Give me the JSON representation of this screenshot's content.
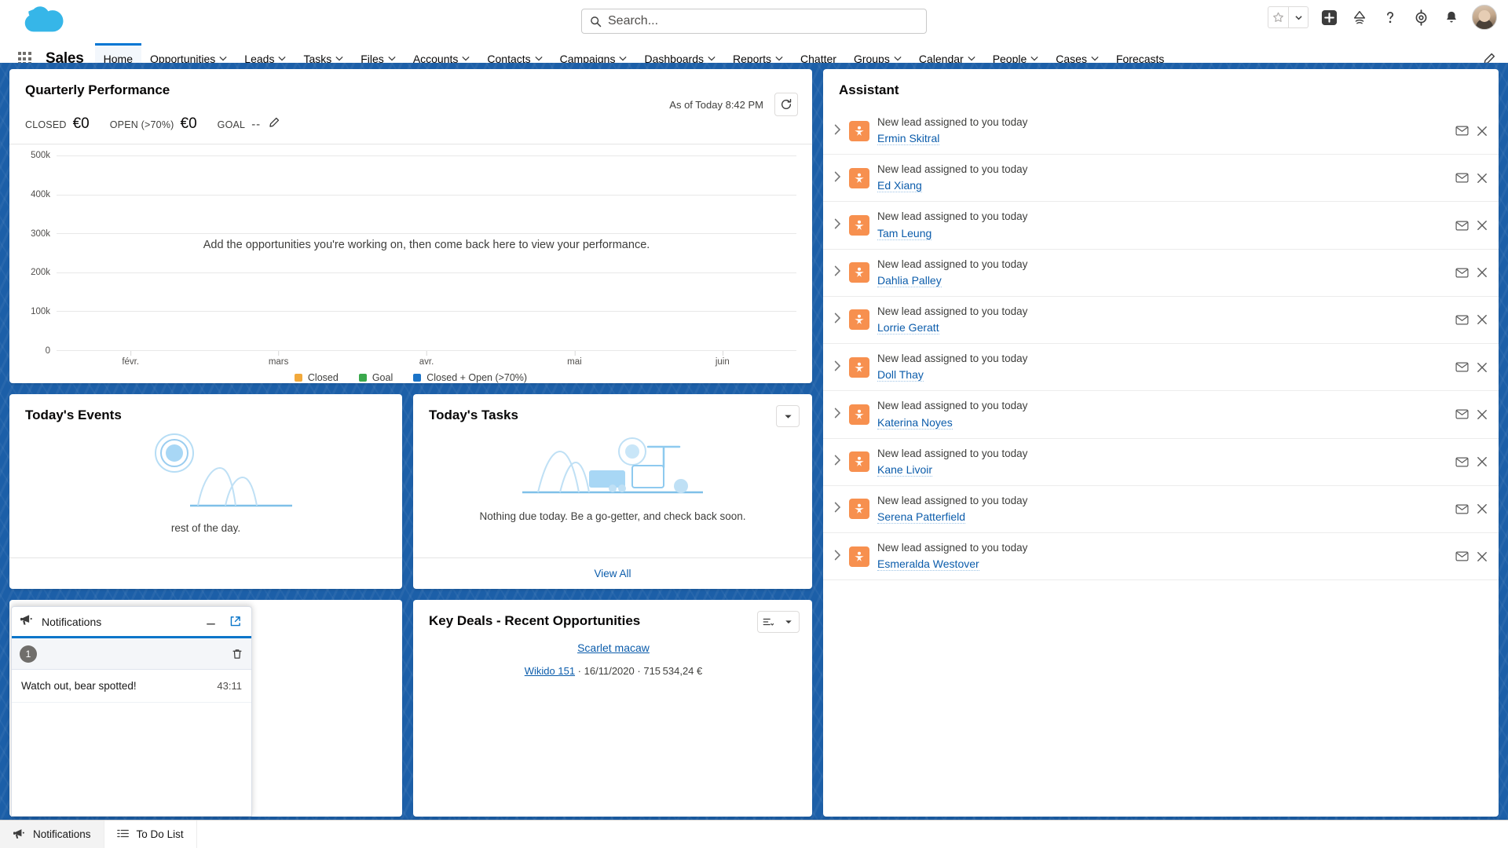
{
  "header": {
    "logo_icon": "salesforce-cloud-logo",
    "search": {
      "placeholder": "Search...",
      "icon": "search-icon",
      "value": ""
    },
    "icons": {
      "favorite": "star-icon",
      "favorite_caret": "chevron-down-icon",
      "add": "plus-circle-icon",
      "learning": "trailhead-icon",
      "help": "question-mark-icon",
      "setup": "gear-icon",
      "notifications": "bell-icon",
      "avatar": "user-avatar"
    }
  },
  "nav": {
    "waffle_icon": "app-launcher-icon",
    "app_name": "Sales",
    "edit_icon": "pencil-icon",
    "items": [
      {
        "label": "Home",
        "has_caret": false,
        "active": true
      },
      {
        "label": "Opportunities",
        "has_caret": true,
        "active": false
      },
      {
        "label": "Leads",
        "has_caret": true,
        "active": false
      },
      {
        "label": "Tasks",
        "has_caret": true,
        "active": false
      },
      {
        "label": "Files",
        "has_caret": true,
        "active": false
      },
      {
        "label": "Accounts",
        "has_caret": true,
        "active": false
      },
      {
        "label": "Contacts",
        "has_caret": true,
        "active": false
      },
      {
        "label": "Campaigns",
        "has_caret": true,
        "active": false
      },
      {
        "label": "Dashboards",
        "has_caret": true,
        "active": false
      },
      {
        "label": "Reports",
        "has_caret": true,
        "active": false
      },
      {
        "label": "Chatter",
        "has_caret": false,
        "active": false
      },
      {
        "label": "Groups",
        "has_caret": true,
        "active": false
      },
      {
        "label": "Calendar",
        "has_caret": true,
        "active": false
      },
      {
        "label": "People",
        "has_caret": true,
        "active": false
      },
      {
        "label": "Cases",
        "has_caret": true,
        "active": false
      },
      {
        "label": "Forecasts",
        "has_caret": false,
        "active": false
      }
    ]
  },
  "quarterly_performance": {
    "title": "Quarterly Performance",
    "as_of": "As of Today 8:42 PM",
    "refresh_icon": "refresh-icon",
    "edit_goal_icon": "pencil-icon",
    "metrics": [
      {
        "label": "CLOSED",
        "value": "€0"
      },
      {
        "label": "OPEN (>70%)",
        "value": "€0"
      },
      {
        "label": "GOAL",
        "value": "--"
      }
    ],
    "empty_message": "Add the opportunities you're working on, then come back here to view your performance."
  },
  "chart_data": {
    "type": "line",
    "title": "Quarterly Performance",
    "xlabel": "",
    "ylabel": "",
    "x": [
      "févr.",
      "mars",
      "avr.",
      "mai",
      "juin"
    ],
    "ytick_labels": [
      "0",
      "100k",
      "200k",
      "300k",
      "400k",
      "500k"
    ],
    "ytick_values": [
      0,
      100000,
      200000,
      300000,
      400000,
      500000
    ],
    "ylim": [
      0,
      500000
    ],
    "grid": true,
    "legend_position": "bottom",
    "series": [
      {
        "name": "Closed",
        "color": "#f2a93b",
        "values": []
      },
      {
        "name": "Goal",
        "color": "#3aa84c",
        "values": []
      },
      {
        "name": "Closed + Open (>70%)",
        "color": "#1a73c7",
        "values": []
      }
    ],
    "annotation": "Add the opportunities you're working on, then come back here to view your performance."
  },
  "todays_events": {
    "title": "Today's Events",
    "empty_text": "rest of the day.",
    "art_icon": "calendar-empty-illustration"
  },
  "todays_tasks": {
    "title": "Today's Tasks",
    "empty_text": "Nothing due today. Be a go-getter, and check back soon.",
    "view_all": "View All",
    "menu_icon": "chevron-down-icon",
    "art_icon": "tasks-empty-illustration"
  },
  "key_deals": {
    "title": "Key Deals - Recent Opportunities",
    "list_icon": "list-view-icon",
    "menu_icon": "chevron-down-icon",
    "deals": [
      {
        "name": "Scarlet macaw",
        "account": "Wikido 151",
        "date": "16/11/2020",
        "amount": "715 534,24 €",
        "separator": "·"
      }
    ]
  },
  "assistant": {
    "title": "Assistant",
    "chevron_icon": "chevron-right-icon",
    "lead_icon": "lead-icon",
    "email_icon": "email-icon",
    "dismiss_icon": "close-icon",
    "items": [
      {
        "text": "New lead assigned to you today",
        "name": "Ermin Skitral"
      },
      {
        "text": "New lead assigned to you today",
        "name": "Ed Xiang"
      },
      {
        "text": "New lead assigned to you today",
        "name": "Tam Leung"
      },
      {
        "text": "New lead assigned to you today",
        "name": "Dahlia Palley"
      },
      {
        "text": "New lead assigned to you today",
        "name": "Lorrie Geratt"
      },
      {
        "text": "New lead assigned to you today",
        "name": "Doll Thay"
      },
      {
        "text": "New lead assigned to you today",
        "name": "Katerina Noyes"
      },
      {
        "text": "New lead assigned to you today",
        "name": "Kane Livoir"
      },
      {
        "text": "New lead assigned to you today",
        "name": "Serena Patterfield"
      },
      {
        "text": "New lead assigned to you today",
        "name": "Esmeralda Westover"
      }
    ]
  },
  "notifications_panel": {
    "title": "Notifications",
    "icon": "megaphone-icon",
    "minimize_icon": "minimize-icon",
    "popout_icon": "popout-icon",
    "badge_count": "1",
    "clear_icon": "trash-icon",
    "items": [
      {
        "message": "Watch out, bear spotted!",
        "time": "43:11"
      }
    ]
  },
  "utility_bar": {
    "items": [
      {
        "label": "Notifications",
        "icon": "megaphone-icon",
        "active": true
      },
      {
        "label": "To Do List",
        "icon": "todo-list-icon",
        "active": false
      }
    ]
  }
}
